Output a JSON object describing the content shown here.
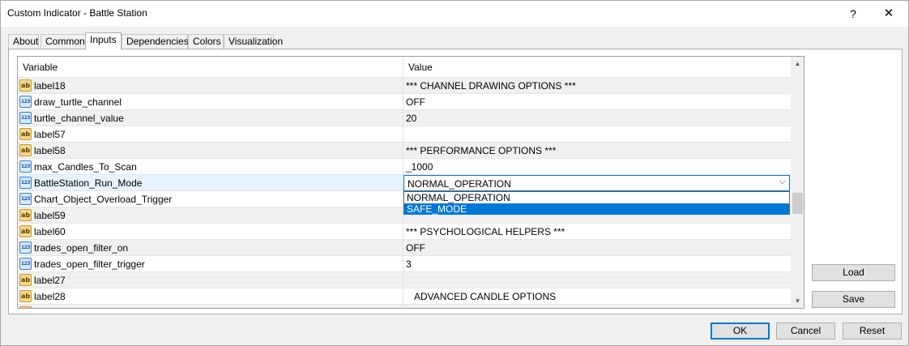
{
  "window": {
    "title": "Custom Indicator - Battle Station",
    "help_label": "?",
    "close_label": "✕"
  },
  "tabs": [
    "About",
    "Common",
    "Inputs",
    "Dependencies",
    "Colors",
    "Visualization"
  ],
  "active_tab": "Inputs",
  "grid": {
    "col_variable": "Variable",
    "col_value": "Value",
    "rows": [
      {
        "icon": "ab",
        "name": "label18",
        "value": "*** CHANNEL DRAWING OPTIONS ***"
      },
      {
        "icon": "num",
        "name": "draw_turtle_channel",
        "value": "OFF"
      },
      {
        "icon": "num",
        "name": "turtle_channel_value",
        "value": "20"
      },
      {
        "icon": "ab",
        "name": "label57",
        "value": ""
      },
      {
        "icon": "ab",
        "name": "label58",
        "value": "*** PERFORMANCE OPTIONS ***"
      },
      {
        "icon": "num",
        "name": "max_Candles_To_Scan",
        "value": "_1000"
      },
      {
        "icon": "num",
        "name": "BattleStation_Run_Mode",
        "value": "NORMAL_OPERATION"
      },
      {
        "icon": "num",
        "name": "Chart_Object_Overload_Trigger",
        "value": ""
      },
      {
        "icon": "ab",
        "name": "label59",
        "value": ""
      },
      {
        "icon": "ab",
        "name": "label60",
        "value": "*** PSYCHOLOGICAL HELPERS ***"
      },
      {
        "icon": "num",
        "name": "trades_open_filter_on",
        "value": "OFF"
      },
      {
        "icon": "num",
        "name": "trades_open_filter_trigger",
        "value": "3"
      },
      {
        "icon": "ab",
        "name": "label27",
        "value": ""
      },
      {
        "icon": "ab",
        "name": "label28",
        "value": "ADVANCED CANDLE OPTIONS"
      }
    ]
  },
  "combo": {
    "selected": "NORMAL_OPERATION",
    "options": [
      "NORMAL_OPERATION",
      "SAFE_MODE"
    ],
    "highlighted": "SAFE_MODE"
  },
  "icons": {
    "ab_text": "ab",
    "num_text": "123",
    "chevron": "⌵",
    "scroll_up": "▲",
    "scroll_down": "▼"
  },
  "side_buttons": {
    "load": "Load",
    "save": "Save"
  },
  "footer": {
    "ok": "OK",
    "cancel": "Cancel",
    "reset": "Reset"
  },
  "colors": {
    "accent": "#0078d7",
    "selected_row": "#e5f3ff",
    "alt_row": "#f0f0f0"
  }
}
